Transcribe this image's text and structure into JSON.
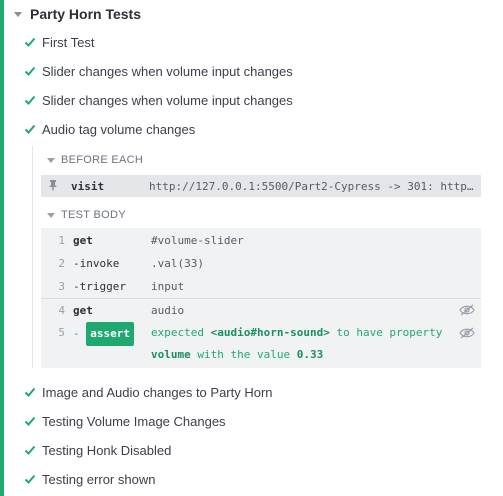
{
  "suite": {
    "title": "Party Horn Tests"
  },
  "tests_before": [
    {
      "label": "First Test"
    },
    {
      "label": "Slider changes when volume input changes"
    },
    {
      "label": "Slider changes when volume input changes"
    },
    {
      "label": "Audio tag volume changes"
    }
  ],
  "before_each": {
    "label": "BEFORE EACH",
    "command": {
      "name": "visit",
      "message": "http://127.0.0.1:5500/Part2-Cypress -> 301: http…"
    }
  },
  "test_body": {
    "label": "TEST BODY",
    "commands": [
      {
        "num": "1",
        "name": "get",
        "message": "#volume-slider"
      },
      {
        "num": "2",
        "name": "-invoke",
        "message": ".val(33)"
      },
      {
        "num": "3",
        "name": "-trigger",
        "message": "input"
      },
      {
        "num": "4",
        "name": "get",
        "message": "audio"
      }
    ],
    "assert": {
      "num": "5",
      "dash": "-",
      "badge": "assert",
      "expected": "expected",
      "subject": "<audio#horn-sound>",
      "middle": "to have property",
      "property": "volume",
      "with_value": "with the value",
      "value": "0.33"
    }
  },
  "tests_after": [
    {
      "label": "Image and Audio changes to Party Horn"
    },
    {
      "label": "Testing Volume Image Changes"
    },
    {
      "label": "Testing Honk Disabled"
    },
    {
      "label": "Testing error shown"
    }
  ],
  "colors": {
    "pass": "#1fa971",
    "text": "#3a3f4b"
  }
}
